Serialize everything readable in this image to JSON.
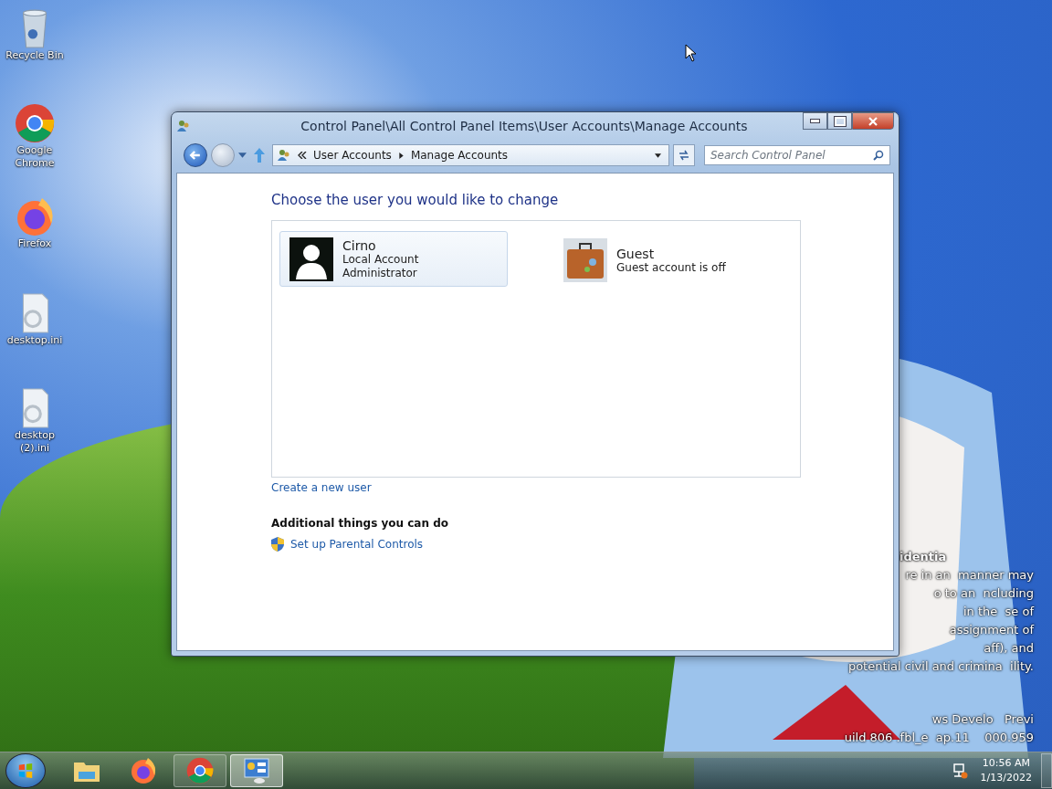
{
  "desktop": {
    "icons": [
      {
        "kind": "recycle",
        "label": "Recycle Bin"
      },
      {
        "kind": "chrome",
        "label": "Google Chrome"
      },
      {
        "kind": "firefox",
        "label": "Firefox"
      },
      {
        "kind": "file",
        "label": "desktop.ini"
      },
      {
        "kind": "file",
        "label": "desktop (2).ini"
      }
    ],
    "overlay_text": [
      "identia",
      "re in an  manner may",
      "o to an  ncluding",
      "in the  se of",
      "assignment of",
      "aff), and",
      "potential civil and crimina  ility.",
      "ws Develo   Previ",
      "uild 806 .fbl_e  ap.11    000.959"
    ]
  },
  "window": {
    "title": "Control Panel\\All Control Panel Items\\User Accounts\\Manage Accounts",
    "breadcrumb": [
      "User Accounts",
      "Manage Accounts"
    ],
    "search": {
      "placeholder": "Search Control Panel"
    },
    "heading": "Choose the user you would like to change",
    "accounts": [
      {
        "kind": "user",
        "name": "Cirno",
        "details": [
          "Local Account",
          "Administrator"
        ],
        "selected": true
      },
      {
        "kind": "guest",
        "name": "Guest",
        "details": [
          "Guest account is off"
        ],
        "selected": false
      }
    ],
    "create_link": "Create a new user",
    "additional_heading": "Additional things you can do",
    "tasks": [
      "Set up Parental Controls"
    ]
  },
  "taskbar": {
    "items": [
      {
        "kind": "explorer",
        "running": false,
        "selected": false
      },
      {
        "kind": "firefox",
        "running": false,
        "selected": false
      },
      {
        "kind": "chrome",
        "running": true,
        "selected": false
      },
      {
        "kind": "controlpanel",
        "running": true,
        "selected": true
      }
    ],
    "time": "10:56 AM",
    "date": "1/13/2022"
  }
}
